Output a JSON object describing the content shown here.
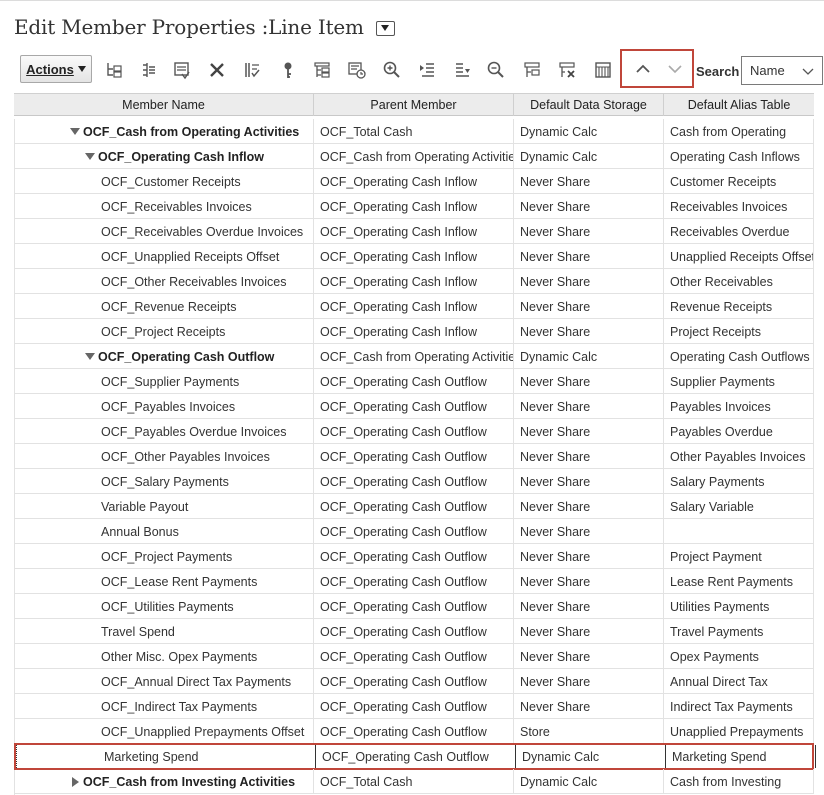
{
  "page": {
    "title": "Edit Member Properties :Line Item"
  },
  "toolbar": {
    "actions_label": "Actions",
    "icons": [
      "add-child-icon",
      "add-sibling-icon",
      "edit-member-icon",
      "delete-icon",
      "move-member-icon",
      "key-icon",
      "refresh-hierarchy-icon",
      "member-history-icon",
      "zoom-in-icon",
      "collapse-icon",
      "expand-icon",
      "zoom-out-icon",
      "sort-icon",
      "clear-icon",
      "grid-view-icon"
    ],
    "nav_up_icon": "chevron-up-icon",
    "nav_down_icon": "chevron-down-icon",
    "search_label": "Search",
    "search_field_value": "Name"
  },
  "grid": {
    "columns": [
      "Member Name",
      "Parent Member",
      "Default Data Storage",
      "Default Alias Table"
    ],
    "rows": [
      {
        "name": "OCF_Cash from Operating Activities",
        "parent": "OCF_Total Cash",
        "storage": "Dynamic Calc",
        "alias": "Cash from Operating",
        "level": 1,
        "bold": true,
        "toggle": "expanded"
      },
      {
        "name": "OCF_Operating Cash Inflow",
        "parent": "OCF_Cash from Operating Activities",
        "storage": "Dynamic Calc",
        "alias": "Operating Cash Inflows",
        "level": 2,
        "bold": true,
        "toggle": "expanded"
      },
      {
        "name": "OCF_Customer Receipts",
        "parent": "OCF_Operating Cash Inflow",
        "storage": "Never Share",
        "alias": "Customer Receipts",
        "level": 3
      },
      {
        "name": "OCF_Receivables Invoices",
        "parent": "OCF_Operating Cash Inflow",
        "storage": "Never Share",
        "alias": "Receivables Invoices",
        "level": 3
      },
      {
        "name": "OCF_Receivables Overdue Invoices",
        "parent": "OCF_Operating Cash Inflow",
        "storage": "Never Share",
        "alias": "Receivables Overdue",
        "level": 3
      },
      {
        "name": "OCF_Unapplied Receipts Offset",
        "parent": "OCF_Operating Cash Inflow",
        "storage": "Never Share",
        "alias": "Unapplied Receipts Offset",
        "level": 3
      },
      {
        "name": "OCF_Other Receivables Invoices",
        "parent": "OCF_Operating Cash Inflow",
        "storage": "Never Share",
        "alias": "Other Receivables",
        "level": 3
      },
      {
        "name": "OCF_Revenue Receipts",
        "parent": "OCF_Operating Cash Inflow",
        "storage": "Never Share",
        "alias": "Revenue Receipts",
        "level": 3
      },
      {
        "name": "OCF_Project Receipts",
        "parent": "OCF_Operating Cash Inflow",
        "storage": "Never Share",
        "alias": "Project Receipts",
        "level": 3
      },
      {
        "name": "OCF_Operating Cash Outflow",
        "parent": "OCF_Cash from Operating Activities",
        "storage": "Dynamic Calc",
        "alias": "Operating Cash Outflows",
        "level": 2,
        "bold": true,
        "toggle": "expanded"
      },
      {
        "name": "OCF_Supplier Payments",
        "parent": "OCF_Operating Cash Outflow",
        "storage": "Never Share",
        "alias": "Supplier Payments",
        "level": 3
      },
      {
        "name": "OCF_Payables Invoices",
        "parent": "OCF_Operating Cash Outflow",
        "storage": "Never Share",
        "alias": "Payables Invoices",
        "level": 3
      },
      {
        "name": "OCF_Payables Overdue Invoices",
        "parent": "OCF_Operating Cash Outflow",
        "storage": "Never Share",
        "alias": "Payables Overdue",
        "level": 3
      },
      {
        "name": "OCF_Other Payables Invoices",
        "parent": "OCF_Operating Cash Outflow",
        "storage": "Never Share",
        "alias": "Other Payables Invoices",
        "level": 3
      },
      {
        "name": "OCF_Salary Payments",
        "parent": "OCF_Operating Cash Outflow",
        "storage": "Never Share",
        "alias": "Salary Payments",
        "level": 3
      },
      {
        "name": "Variable Payout",
        "parent": "OCF_Operating Cash Outflow",
        "storage": "Never Share",
        "alias": "Salary Variable",
        "level": 3
      },
      {
        "name": "Annual Bonus",
        "parent": "OCF_Operating Cash Outflow",
        "storage": "Never Share",
        "alias": "",
        "level": 3
      },
      {
        "name": "OCF_Project Payments",
        "parent": "OCF_Operating Cash Outflow",
        "storage": "Never Share",
        "alias": "Project Payment",
        "level": 3
      },
      {
        "name": "OCF_Lease Rent Payments",
        "parent": "OCF_Operating Cash Outflow",
        "storage": "Never Share",
        "alias": "Lease Rent Payments",
        "level": 3
      },
      {
        "name": "OCF_Utilities Payments",
        "parent": "OCF_Operating Cash Outflow",
        "storage": "Never Share",
        "alias": "Utilities Payments",
        "level": 3
      },
      {
        "name": "Travel Spend",
        "parent": "OCF_Operating Cash Outflow",
        "storage": "Never Share",
        "alias": "Travel Payments",
        "level": 3
      },
      {
        "name": "Other Misc. Opex Payments",
        "parent": "OCF_Operating Cash Outflow",
        "storage": "Never Share",
        "alias": "Opex Payments",
        "level": 3
      },
      {
        "name": "OCF_Annual Direct Tax Payments",
        "parent": "OCF_Operating Cash Outflow",
        "storage": "Never Share",
        "alias": "Annual Direct Tax",
        "level": 3
      },
      {
        "name": "OCF_Indirect Tax Payments",
        "parent": "OCF_Operating Cash Outflow",
        "storage": "Never Share",
        "alias": "Indirect Tax Payments",
        "level": 3
      },
      {
        "name": "OCF_Unapplied Prepayments Offset",
        "parent": "OCF_Operating Cash Outflow",
        "storage": "Store",
        "alias": "Unapplied Prepayments",
        "level": 3
      },
      {
        "name": "Marketing Spend",
        "parent": "OCF_Operating Cash Outflow",
        "storage": "Dynamic Calc",
        "alias": "Marketing Spend",
        "level": 3,
        "selected": true
      },
      {
        "name": "OCF_Cash from Investing Activities",
        "parent": "OCF_Total Cash",
        "storage": "Dynamic Calc",
        "alias": "Cash from Investing",
        "level": 1,
        "bold": true,
        "toggle": "collapsed"
      }
    ]
  },
  "colors": {
    "highlight_border": "#c0463a",
    "header_bg": "#ececec"
  }
}
